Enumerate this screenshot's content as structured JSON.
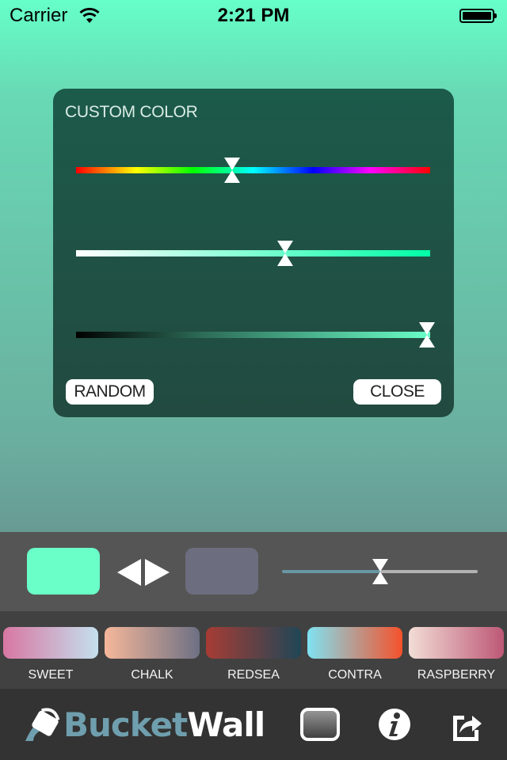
{
  "status_bar": {
    "carrier": "Carrier",
    "time": "2:21 PM",
    "battery_level_percent": 100
  },
  "custom_color_panel": {
    "title": "CUSTOM COLOR",
    "sliders": [
      {
        "name": "hue",
        "value_fraction": 0.44
      },
      {
        "name": "saturation",
        "value_fraction": 0.59
      },
      {
        "name": "brightness",
        "value_fraction": 0.99
      }
    ],
    "random_label": "RANDOM",
    "close_label": "CLOSE"
  },
  "gradient_controls": {
    "color_a": "#6affc8",
    "color_b": "#6c6e7f",
    "swap_icon": "swap-arrows-icon",
    "blend_slider_value_fraction": 0.5,
    "blend_track_left_color": "#6a97a5",
    "blend_track_right_color": "#b2b2b2"
  },
  "presets": [
    {
      "label": "SWEET",
      "from": "#d877a2",
      "to": "#c4e0ee"
    },
    {
      "label": "CHALK",
      "from": "#f6b79a",
      "to": "#6d7084"
    },
    {
      "label": "REDSEA",
      "from": "#a73c34",
      "to": "#1f4656"
    },
    {
      "label": "CONTRA",
      "from": "#7fe2f2",
      "to": "#f5512a"
    },
    {
      "label": "RASPBERRY",
      "from": "#f2ddd6",
      "to": "#bd5876"
    }
  ],
  "footer": {
    "logo_part1": "Bucket",
    "logo_part2": "Wall",
    "icons": [
      "wallpaper-preview-icon",
      "info-icon",
      "share-icon"
    ]
  }
}
